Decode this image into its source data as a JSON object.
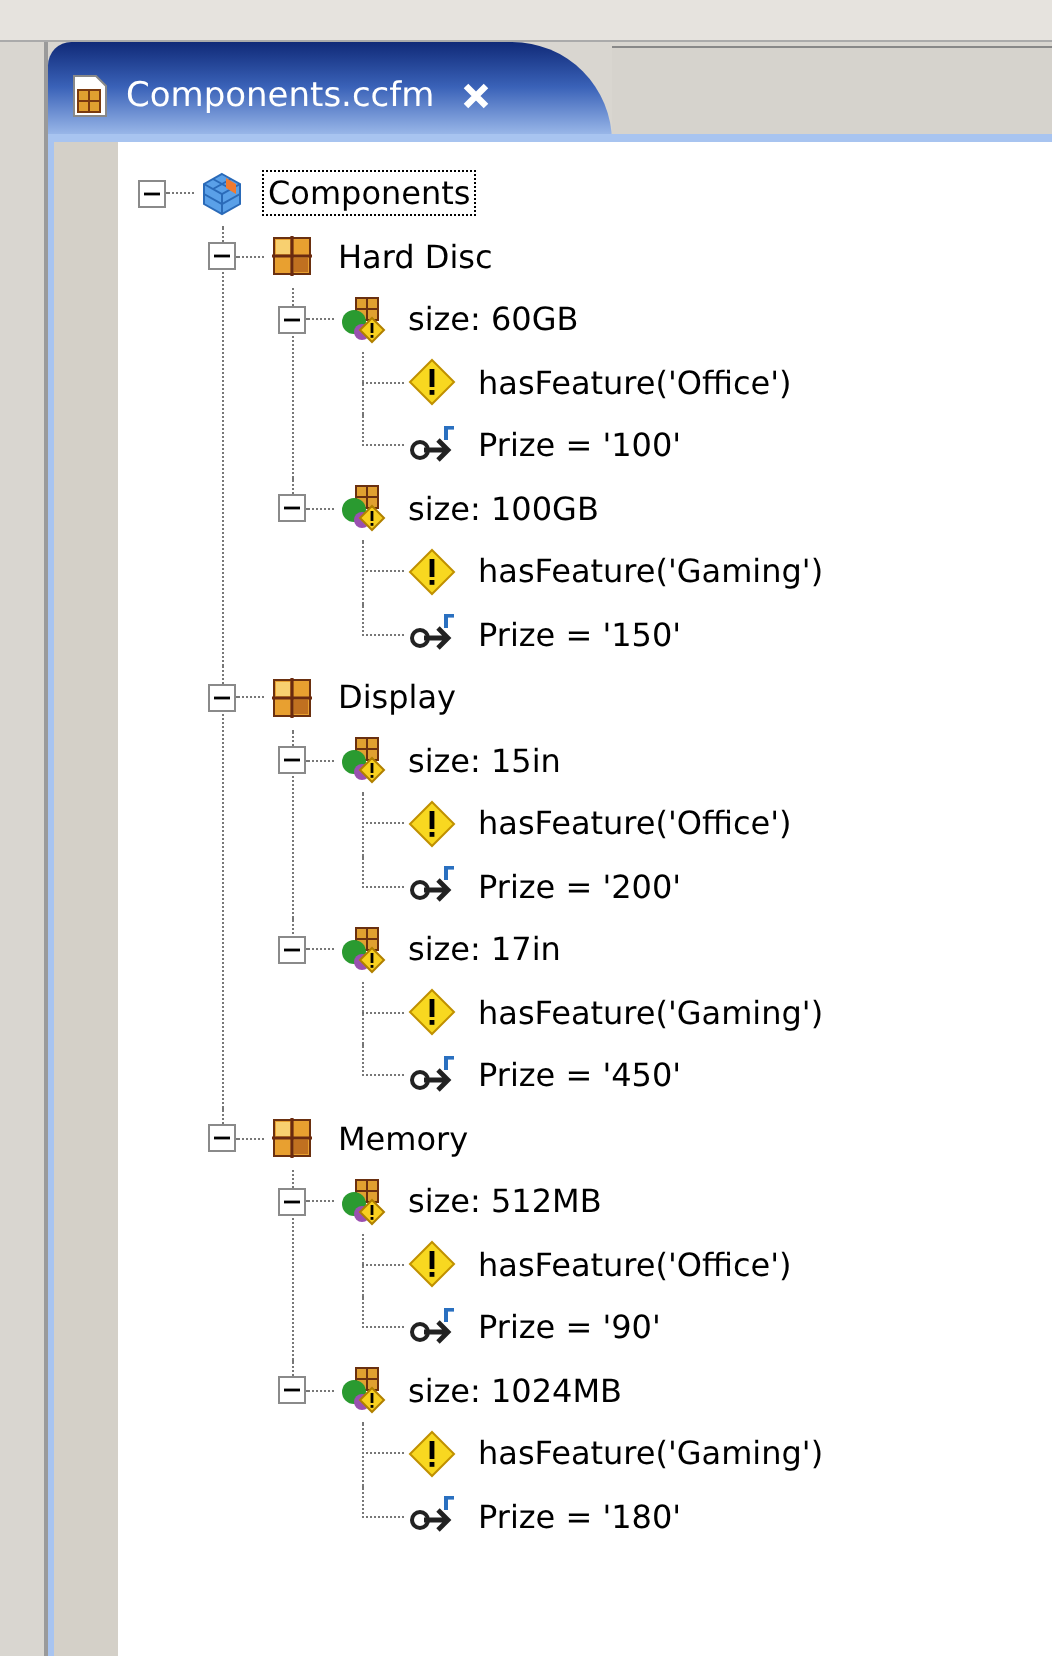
{
  "editor_tab": {
    "title": "Components.ccfm"
  },
  "tree": [
    {
      "label": "Components",
      "kind": "root",
      "expanded": true,
      "selected": true,
      "children": [
        {
          "label": "Hard Disc",
          "kind": "feature",
          "expanded": true,
          "selected": false,
          "children": [
            {
              "label": "size: 60GB",
              "kind": "option",
              "expanded": true,
              "selected": false,
              "children": [
                {
                  "label": "hasFeature('Office')",
                  "kind": "constraint",
                  "selected": false
                },
                {
                  "label": "Prize = '100'",
                  "kind": "attribute",
                  "selected": false
                }
              ]
            },
            {
              "label": "size: 100GB",
              "kind": "option",
              "expanded": true,
              "selected": false,
              "children": [
                {
                  "label": "hasFeature('Gaming')",
                  "kind": "constraint",
                  "selected": false
                },
                {
                  "label": "Prize = '150'",
                  "kind": "attribute",
                  "selected": false
                }
              ]
            }
          ]
        },
        {
          "label": "Display",
          "kind": "feature",
          "expanded": true,
          "selected": false,
          "children": [
            {
              "label": "size: 15in",
              "kind": "option",
              "expanded": true,
              "selected": false,
              "children": [
                {
                  "label": "hasFeature('Office')",
                  "kind": "constraint",
                  "selected": false
                },
                {
                  "label": "Prize = '200'",
                  "kind": "attribute",
                  "selected": false
                }
              ]
            },
            {
              "label": "size: 17in",
              "kind": "option",
              "expanded": true,
              "selected": false,
              "children": [
                {
                  "label": "hasFeature('Gaming')",
                  "kind": "constraint",
                  "selected": false
                },
                {
                  "label": "Prize = '450'",
                  "kind": "attribute",
                  "selected": false
                }
              ]
            }
          ]
        },
        {
          "label": "Memory",
          "kind": "feature",
          "expanded": true,
          "selected": false,
          "children": [
            {
              "label": "size: 512MB",
              "kind": "option",
              "expanded": true,
              "selected": false,
              "children": [
                {
                  "label": "hasFeature('Office')",
                  "kind": "constraint",
                  "selected": false
                },
                {
                  "label": "Prize = '90'",
                  "kind": "attribute",
                  "selected": false
                }
              ]
            },
            {
              "label": "size: 1024MB",
              "kind": "option",
              "expanded": true,
              "selected": false,
              "children": [
                {
                  "label": "hasFeature('Gaming')",
                  "kind": "constraint",
                  "selected": false
                },
                {
                  "label": "Prize = '180'",
                  "kind": "attribute",
                  "selected": false
                }
              ]
            }
          ]
        }
      ]
    }
  ]
}
